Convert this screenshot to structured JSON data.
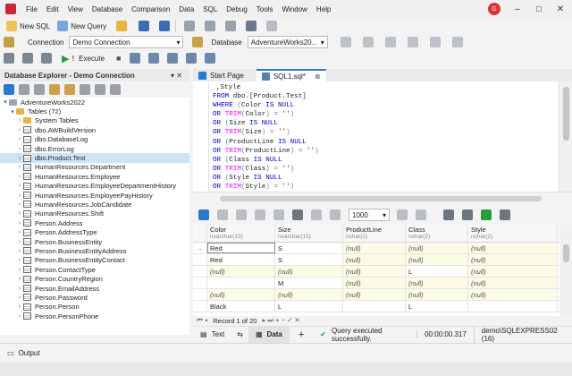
{
  "menu": [
    "File",
    "Edit",
    "View",
    "Database",
    "Comparison",
    "Data",
    "SQL",
    "Debug",
    "Tools",
    "Window",
    "Help"
  ],
  "toolbar1": {
    "new_sql": "New SQL",
    "new_query": "New Query"
  },
  "toolbar2": {
    "connection_label": "Connection",
    "connection_value": "Demo Connection",
    "database_label": "Database",
    "database_value": "AdventureWorks20..."
  },
  "toolbar3": {
    "execute": "Execute"
  },
  "explorer": {
    "title": "Database Explorer - Demo Connection",
    "root": "AdventureWorks2022",
    "tables": "Tables (72)",
    "system_tables": "System Tables",
    "items": [
      "dbo.AWBuildVersion",
      "dbo.DatabaseLog",
      "dbo.ErrorLog",
      "dbo.Product.Test",
      "HumanResources.Department",
      "HumanResources.Employee",
      "HumanResources.EmployeeDepartmentHistory",
      "HumanResources.EmployeePayHistory",
      "HumanResources.JobCandidate",
      "HumanResources.Shift",
      "Person.Address",
      "Person.AddressType",
      "Person.BusinessEntity",
      "Person.BusinessEntityAddress",
      "Person.BusinessEntityContact",
      "Person.ContactType",
      "Person.CountryRegion",
      "Person.EmailAddress",
      "Person.Password",
      "Person.Person",
      "Person.PersonPhone"
    ]
  },
  "tabs": {
    "start": "Start Page",
    "sql": "SQL1.sql*"
  },
  "code": [
    ",Style",
    "FROM dbo.[Product.Test]",
    "WHERE (Color IS NULL",
    "OR TRIM(Color) = '')",
    "OR (Size IS NULL",
    "OR TRIM(Size) = '')",
    "OR (ProductLine IS NULL",
    "OR TRIM(ProductLine) = '')",
    "OR (Class IS NULL",
    "OR TRIM(Class) = '')",
    "OR (Style IS NULL",
    "OR TRIM(Style) = '')"
  ],
  "results": {
    "page_size": "1000",
    "columns": [
      {
        "name": "Color",
        "type": "nvarchar(15)"
      },
      {
        "name": "Size",
        "type": "nvarchar(15)"
      },
      {
        "name": "ProductLine",
        "type": "nchar(2)"
      },
      {
        "name": "Class",
        "type": "nchar(2)"
      },
      {
        "name": "Style",
        "type": "nchar(2)"
      }
    ],
    "rows": [
      [
        "Red",
        "S",
        "(null)",
        "(null)",
        "(null)"
      ],
      [
        "Red",
        "S",
        "(null)",
        "(null)",
        "(null)"
      ],
      [
        "(null)",
        "(null)",
        "(null)",
        "L",
        "(null)"
      ],
      [
        "",
        "M",
        "(null)",
        "(null)",
        "(null)"
      ],
      [
        "(null)",
        "(null)",
        "(null)",
        "(null)",
        "(null)"
      ],
      [
        "Black",
        "L",
        "",
        "L",
        ""
      ]
    ],
    "nav": "Record 1 of 20"
  },
  "status": {
    "text_tab": "Text",
    "data_tab": "Data",
    "message": "Query executed successfully.",
    "time": "00:00:00.317",
    "server": "demo\\SQLEXPRESS02 (16)"
  },
  "output": "Output"
}
